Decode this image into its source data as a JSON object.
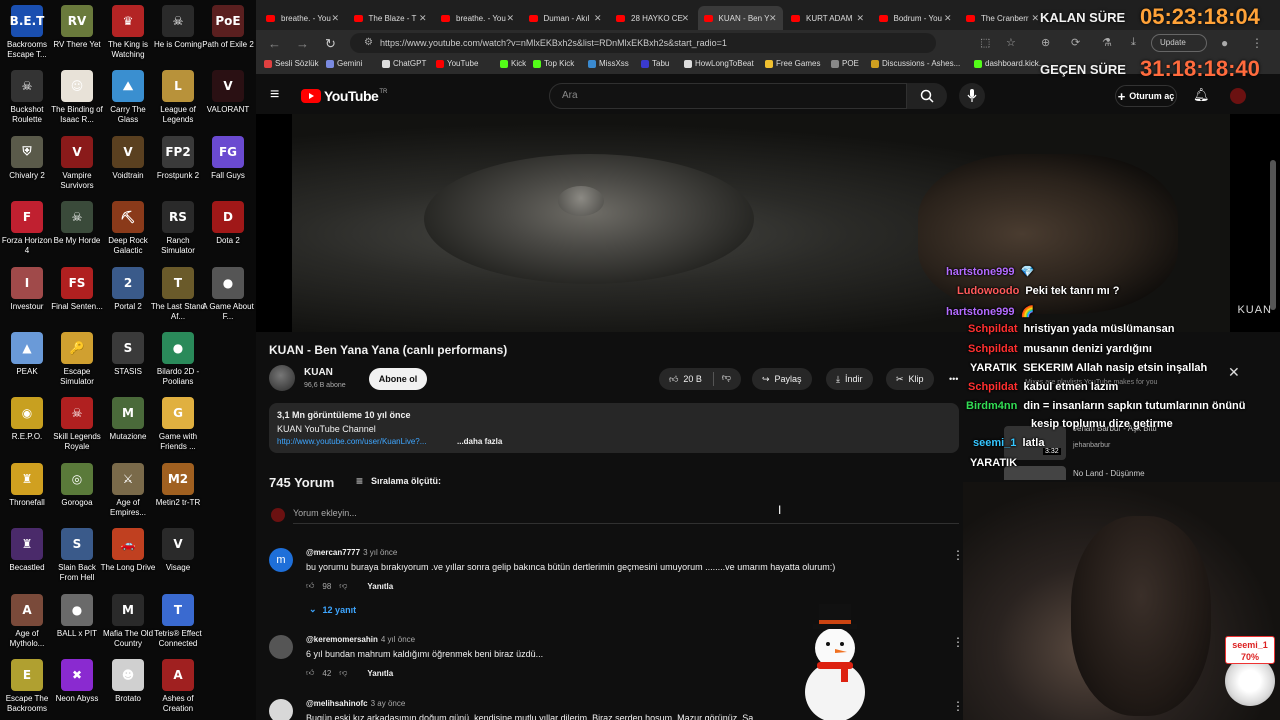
{
  "desktop": {
    "icons": [
      {
        "label": "Backrooms Escape T...",
        "glyph": "B.E.T",
        "color": "#1a4fb0"
      },
      {
        "label": "RV There Yet",
        "glyph": "RV",
        "color": "#6a7a3c"
      },
      {
        "label": "The King is Watching",
        "glyph": "♛",
        "color": "#b32424"
      },
      {
        "label": "He is Coming",
        "glyph": "☠",
        "color": "#2a2a2a"
      },
      {
        "label": "Path of Exile 2",
        "glyph": "PoE",
        "color": "#5a1f1f"
      },
      {
        "label": "Buckshot Roulette",
        "glyph": "☠",
        "color": "#333333"
      },
      {
        "label": "The Binding of Isaac R...",
        "glyph": "☺",
        "color": "#e8e2d8"
      },
      {
        "label": "Carry The Glass",
        "glyph": "⛰",
        "color": "#3a8fd0"
      },
      {
        "label": "League of Legends",
        "glyph": "L",
        "color": "#b8923a"
      },
      {
        "label": "VALORANT",
        "glyph": "V",
        "color": "#2a1013"
      },
      {
        "label": "Chivalry 2",
        "glyph": "⛨",
        "color": "#5a5a4a"
      },
      {
        "label": "Vampire Survivors",
        "glyph": "V",
        "color": "#8a1a1a"
      },
      {
        "label": "Voidtrain",
        "glyph": "V",
        "color": "#5a4020"
      },
      {
        "label": "Frostpunk 2",
        "glyph": "FP2",
        "color": "#3a3a3a"
      },
      {
        "label": "Fall Guys",
        "glyph": "FG",
        "color": "#6a4ad0"
      },
      {
        "label": "Forza Horizon 4",
        "glyph": "F",
        "color": "#c02030"
      },
      {
        "label": "Be My Horde",
        "glyph": "☠",
        "color": "#3a4a3a"
      },
      {
        "label": "Deep Rock Galactic",
        "glyph": "⛏",
        "color": "#8a3a1a"
      },
      {
        "label": "Ranch Simulator",
        "glyph": "RS",
        "color": "#2a2a2a"
      },
      {
        "label": "Dota 2",
        "glyph": "D",
        "color": "#a01818"
      },
      {
        "label": "Investour",
        "glyph": "I",
        "color": "#a04a4a"
      },
      {
        "label": "Final Senten...",
        "glyph": "FS",
        "color": "#b02020"
      },
      {
        "label": "Portal 2",
        "glyph": "2",
        "color": "#3a5a8a"
      },
      {
        "label": "The Last Stand Af...",
        "glyph": "T",
        "color": "#6a5a2a"
      },
      {
        "label": "A Game About F...",
        "glyph": "●",
        "color": "#555555"
      },
      {
        "label": "PEAK",
        "glyph": "▲",
        "color": "#6a9ad8"
      },
      {
        "label": "Escape Simulator",
        "glyph": "🔑",
        "color": "#d0a030"
      },
      {
        "label": "STASIS",
        "glyph": "S",
        "color": "#3a3a3a"
      },
      {
        "label": "Bilardo 2D - Poolians",
        "glyph": "●",
        "color": "#2a8a5a"
      },
      {
        "label": "",
        "glyph": "",
        "color": ""
      },
      {
        "label": "R.E.P.O.",
        "glyph": "◉",
        "color": "#c8a020"
      },
      {
        "label": "Skill Legends Royale",
        "glyph": "☠",
        "color": "#b02020"
      },
      {
        "label": "Mutazione",
        "glyph": "M",
        "color": "#4a6a3a"
      },
      {
        "label": "Game with Friends ...",
        "glyph": "G",
        "color": "#e0b040"
      },
      {
        "label": "",
        "glyph": "",
        "color": ""
      },
      {
        "label": "Thronefall",
        "glyph": "♜",
        "color": "#d0a020"
      },
      {
        "label": "Gorogoa",
        "glyph": "◎",
        "color": "#5a7a3a"
      },
      {
        "label": "Age of Empires...",
        "glyph": "⚔",
        "color": "#7a6a4a"
      },
      {
        "label": "Metin2 tr-TR",
        "glyph": "M2",
        "color": "#a06020"
      },
      {
        "label": "",
        "glyph": "",
        "color": ""
      },
      {
        "label": "Becastled",
        "glyph": "♜",
        "color": "#4a2a6a"
      },
      {
        "label": "Slain Back From Hell",
        "glyph": "S",
        "color": "#3a5a8a"
      },
      {
        "label": "The Long Drive",
        "glyph": "🚗",
        "color": "#c04020"
      },
      {
        "label": "Visage",
        "glyph": "V",
        "color": "#2a2a2a"
      },
      {
        "label": "",
        "glyph": "",
        "color": ""
      },
      {
        "label": "Age of Mytholo...",
        "glyph": "A",
        "color": "#7a4a3a"
      },
      {
        "label": "BALL x PIT",
        "glyph": "●",
        "color": "#6a6a6a"
      },
      {
        "label": "Mafia The Old Country",
        "glyph": "M",
        "color": "#2a2a2a"
      },
      {
        "label": "Tetris® Effect Connected",
        "glyph": "T",
        "color": "#3a6ad0"
      },
      {
        "label": "",
        "glyph": "",
        "color": ""
      },
      {
        "label": "Escape The Backrooms",
        "glyph": "E",
        "color": "#b0a030"
      },
      {
        "label": "Neon Abyss",
        "glyph": "✖",
        "color": "#8a2ad0"
      },
      {
        "label": "Brotato",
        "glyph": "☻",
        "color": "#d0d0d0"
      },
      {
        "label": "Ashes of Creation",
        "glyph": "A",
        "color": "#a02020"
      }
    ]
  },
  "tabs": [
    {
      "label": "breathe. - You",
      "active": false
    },
    {
      "label": "The Blaze - T",
      "active": false
    },
    {
      "label": "breathe. - You",
      "active": false
    },
    {
      "label": "Duman - Akıl",
      "active": false
    },
    {
      "label": "28 HAYKO CE",
      "active": false
    },
    {
      "label": "KUAN - Ben Y",
      "active": true
    },
    {
      "label": "KURT ADAM",
      "active": false
    },
    {
      "label": "Bodrum - You",
      "active": false
    },
    {
      "label": "The Cranberr",
      "active": false
    }
  ],
  "address": {
    "url": "https://www.youtube.com/watch?v=nMlxEKBxh2s&list=RDnMlxEKBxh2s&start_radio=1",
    "update_label": "Update"
  },
  "bookmarks": [
    {
      "label": "Sesli Sözlük",
      "color": "#e04040"
    },
    {
      "label": "Gemini",
      "color": "#7a8ae0"
    },
    {
      "label": "ChatGPT",
      "color": "#dddddd"
    },
    {
      "label": "YouTube",
      "color": "#ff0000"
    },
    {
      "label": "Kick",
      "color": "#53fc18"
    },
    {
      "label": "Top Kick",
      "color": "#53fc18"
    },
    {
      "label": "MissXss",
      "color": "#3a8ad0"
    },
    {
      "label": "Tabu",
      "color": "#3a3ad0"
    },
    {
      "label": "HowLongToBeat",
      "color": "#dddddd"
    },
    {
      "label": "Free Games",
      "color": "#f0c030"
    },
    {
      "label": "POE",
      "color": "#888888"
    },
    {
      "label": "Discussions - Ashes...",
      "color": "#d0a020"
    },
    {
      "label": "dashboard.kick...",
      "color": "#53fc18"
    }
  ],
  "youtube": {
    "logo_text": "YouTube",
    "region": "TR",
    "search_placeholder": "Ara",
    "signin_label": "Oturum aç",
    "video_watermark": "KUAN",
    "title": "KUAN - Ben Yana Yana (canlı performans)",
    "channel": "KUAN",
    "subscribers": "96,6 B abone",
    "subscribe_label": "Abone ol",
    "likes": "20 B",
    "share_label": "Paylaş",
    "download_label": "İndir",
    "clip_label": "Klip",
    "description": {
      "line1": "3,1 Mn görüntüleme  10 yıl önce",
      "line2": "KUAN YouTube Channel",
      "link": "http://www.youtube.com/user/KuanLive?...",
      "more": "...daha fazla"
    },
    "comments_count": "745 Yorum",
    "sort_label": "Sıralama ölçütü:",
    "add_comment_placeholder": "Yorum ekleyin...",
    "comments": [
      {
        "author": "@mercan7777",
        "when": "3 yıl önce",
        "body": "bu yorumu  buraya bırakıyorum .ve yıllar sonra gelip bakınca bütün dertlerimin geçmesini umuyorum ........ve umarım hayatta olurum:)",
        "likes": "98",
        "reply": "Yanıtla",
        "avatar_letter": "m",
        "avatar_color": "#1e6fd9"
      },
      {
        "author": "@keremomersahin",
        "when": "4 yıl önce",
        "body": "6 yıl bundan mahrum kaldığımı öğrenmek beni biraz üzdü...",
        "likes": "42",
        "reply": "Yanıtla",
        "avatar_letter": "",
        "avatar_color": "#555555"
      },
      {
        "author": "@melihsahinofc",
        "when": "3 ay önce",
        "body": "Bugün eski kız arkadaşımın doğum günü, kendisine mutlu yıllar dilerim. Biraz serden hoşum. Mazur görünüz. Sa",
        "likes": "",
        "reply": "",
        "avatar_letter": "",
        "avatar_color": "#d8d8d8"
      }
    ],
    "replies_toggle": "12 yanıt",
    "playlist": {
      "subtitle": "Mixes are playlists YouTube makes for you",
      "item1_title": "Jehan Barbur - Aşk Bitti",
      "item1_channel": "jehanbarbur",
      "item1_duration": "3:32",
      "item2_title": "No Land - Düşünme"
    }
  },
  "chat": [
    {
      "user": "hartstone999",
      "message": "💎",
      "color": "#b36bff"
    },
    {
      "user": "Ludowoodo",
      "message": "Peki tek tanrı mı ?",
      "color": "#ff5a5a"
    },
    {
      "user": "hartstone999",
      "message": "🌈",
      "color": "#b36bff"
    },
    {
      "user": "Schpildat",
      "message": "hristiyan yada müslümansan",
      "color": "#ff3030"
    },
    {
      "user": "Schpildat",
      "message": "musanın denizi yardığını",
      "color": "#ff3030"
    },
    {
      "user": "YARATIK",
      "message": "SEKERIM Allah nasip etsin inşallah",
      "color": "#ffffff"
    },
    {
      "user": "Schpildat",
      "message": "kabul etmen lazım",
      "color": "#ff3030"
    },
    {
      "user": "Birdm4nn",
      "message": "din = insanların sapkın tutumlarının önünü",
      "color": "#33dd55"
    },
    {
      "user": "",
      "message": "kesip toplumu dize getirme",
      "color": "#ffffff"
    },
    {
      "user": "seemi_1",
      "message": "latla",
      "color": "#36c6ff"
    },
    {
      "user": "YARATIK",
      "message": "",
      "color": "#ffffff"
    }
  ],
  "timers": {
    "remaining_label": "KALAN SÜRE",
    "remaining_value": "05:23:18:04",
    "elapsed_label": "GEÇEN SÜRE",
    "elapsed_value": "31:18:18:40"
  },
  "webcam_badge": {
    "name": "seemi_1",
    "percent": "70%"
  }
}
